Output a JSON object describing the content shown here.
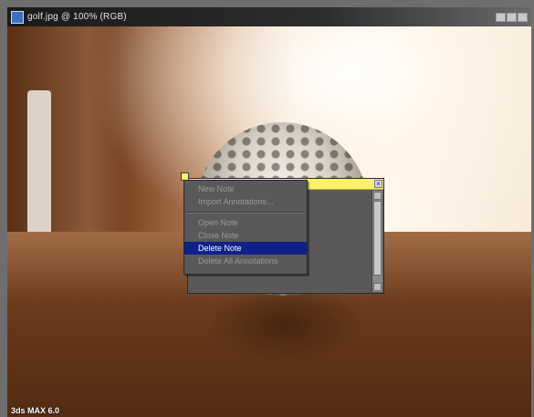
{
  "window": {
    "title": "golf.jpg @ 100% (RGB)",
    "icon": "image-file-icon"
  },
  "canvas": {
    "watermark": "3ds MAX 6.0"
  },
  "note": {
    "close_glyph": "×"
  },
  "context_menu": {
    "items": [
      {
        "label": "New Note",
        "enabled": false
      },
      {
        "label": "Import Annotations...",
        "enabled": false
      },
      {
        "label": "Open Note",
        "enabled": false
      },
      {
        "label": "Close Note",
        "enabled": false
      },
      {
        "label": "Delete Note",
        "enabled": true,
        "highlighted": true
      },
      {
        "label": "Delete All Annotations",
        "enabled": false
      }
    ]
  },
  "colors": {
    "note_yellow": "#f7f26a",
    "menu_highlight": "#10218a",
    "menu_bg": "#595959"
  }
}
